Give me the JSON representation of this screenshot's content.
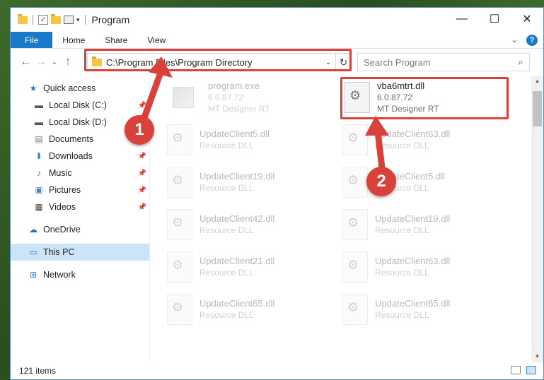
{
  "window": {
    "title": "Program",
    "controls": {
      "minimize": "—",
      "maximize": "☐",
      "close": "✕"
    }
  },
  "ribbon": {
    "tabs": [
      "File",
      "Home",
      "Share",
      "View"
    ],
    "expand": "⌄",
    "help": "?"
  },
  "nav": {
    "back": "←",
    "forward": "→",
    "recent": "⌄",
    "up": "↑"
  },
  "address": {
    "path": "C:\\Program Files\\Program Directory",
    "dropdown": "⌄",
    "refresh": "↻"
  },
  "search": {
    "placeholder": "Search Program"
  },
  "sidebar": {
    "items": [
      {
        "label": "Quick access",
        "icon": "star-icon",
        "pinned": false
      },
      {
        "label": "Local Disk (C:)",
        "icon": "drive-icon",
        "pinned": true
      },
      {
        "label": "Local Disk (D:)",
        "icon": "drive-icon",
        "pinned": false
      },
      {
        "label": "Documents",
        "icon": "documents-icon",
        "pinned": false
      },
      {
        "label": "Downloads",
        "icon": "download-icon",
        "pinned": true
      },
      {
        "label": "Music",
        "icon": "music-icon",
        "pinned": true
      },
      {
        "label": "Pictures",
        "icon": "pictures-icon",
        "pinned": true
      },
      {
        "label": "Videos",
        "icon": "videos-icon",
        "pinned": true
      },
      {
        "label": "OneDrive",
        "icon": "cloud-icon",
        "pinned": false
      },
      {
        "label": "This PC",
        "icon": "pc-icon",
        "pinned": false,
        "selected": true
      },
      {
        "label": "Network",
        "icon": "network-icon",
        "pinned": false
      }
    ]
  },
  "files": {
    "highlighted": {
      "name": "vba6mtrt.dll",
      "version": "6.0.87.72",
      "company": "MT Designer RT"
    },
    "program_exe": {
      "name": "program.exe",
      "version": "6.0.87.72",
      "company": "MT Designer RT"
    },
    "left_col": [
      {
        "name": "UpdateClient5.dll",
        "type": "Resource DLL"
      },
      {
        "name": "UpdateClient19.dll",
        "type": "Resource DLL"
      },
      {
        "name": "UpdateClient42.dll",
        "type": "Resource DLL"
      },
      {
        "name": "UpdateClient21.dll",
        "type": "Resource DLL"
      },
      {
        "name": "UpdateClient65.dll",
        "type": "Resource DLL"
      }
    ],
    "right_col": [
      {
        "name": "UpdateClient63.dll",
        "type": "Resource DLL"
      },
      {
        "name": "UpdateClient5.dll",
        "type": "Resource DLL"
      },
      {
        "name": "UpdateClient19.dll",
        "type": "Resource DLL"
      },
      {
        "name": "UpdateClient63.dll",
        "type": "Resource DLL"
      },
      {
        "name": "UpdateClient65.dll",
        "type": "Resource DLL"
      }
    ]
  },
  "status": {
    "count": "121 items"
  },
  "annotations": {
    "badge1": "1",
    "badge2": "2",
    "color": "#d9413a"
  }
}
